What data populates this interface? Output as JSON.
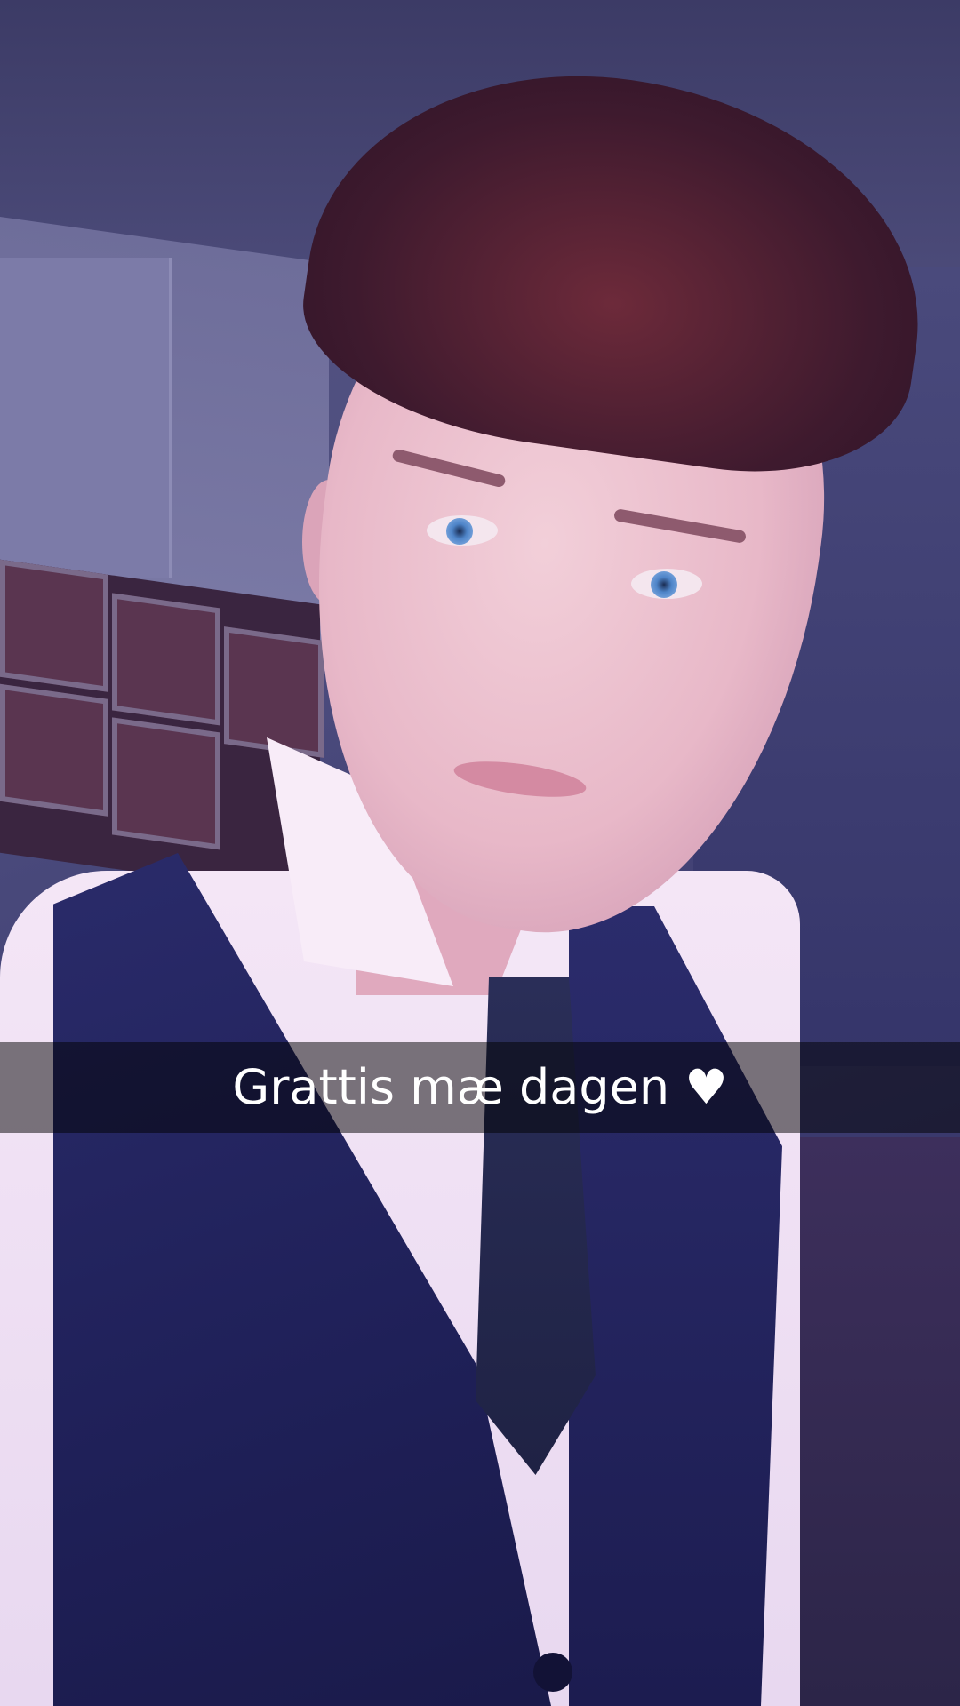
{
  "caption": {
    "text": "Grattis mæ dagen ♥"
  },
  "colors": {
    "caption_bar": "#000000",
    "caption_text": "#ffffff"
  }
}
